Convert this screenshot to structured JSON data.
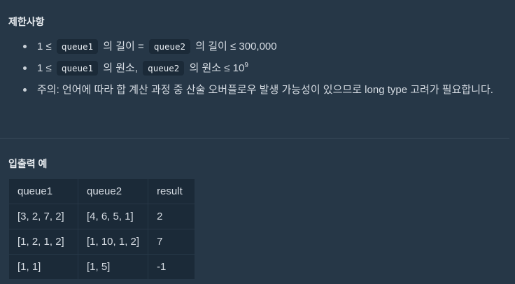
{
  "constraints_title": "제한사항",
  "constraints": [
    {
      "pre": "1 ≤",
      "code1": "queue1",
      "mid": "의 길이 =",
      "code2": "queue2",
      "post": "의 길이 ≤ 300,000"
    },
    {
      "pre": "1 ≤",
      "code1": "queue1",
      "mid": "의 원소,",
      "code2": "queue2",
      "post": "의 원소 ≤ 10",
      "sup": "9"
    },
    {
      "text": "주의: 언어에 따라 합 계산 과정 중 산술 오버플로우 발생 가능성이 있으므로 long type 고려가 필요합니다."
    }
  ],
  "io_title": "입출력 예",
  "io_table": {
    "headers": [
      "queue1",
      "queue2",
      "result"
    ],
    "rows": [
      [
        "[3, 2, 7, 2]",
        "[4, 6, 5, 1]",
        "2"
      ],
      [
        "[1, 2, 1, 2]",
        "[1, 10, 1, 2]",
        "7"
      ],
      [
        "[1, 1]",
        "[1, 5]",
        "-1"
      ]
    ]
  }
}
